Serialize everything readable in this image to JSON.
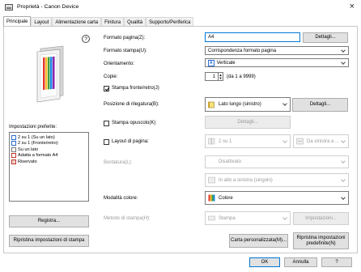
{
  "window": {
    "title": "Proprietà - Canon Device",
    "close_glyph": "×"
  },
  "tabs": [
    "Principale",
    "Layout",
    "Alimentazione carta",
    "Finitura",
    "Qualità",
    "Supporto/Periferica"
  ],
  "preview": {
    "help_glyph": "?"
  },
  "presets": {
    "label": "Impostazioni preferite:",
    "items": [
      "2 su 1 (Su un lato)",
      "2 su 1 (Fronte/retro)",
      "Su un lato",
      "Adatta a formato A4",
      "Riservato"
    ],
    "register_button": "Registra...",
    "restore_button": "Ripristina impostazioni di stampa"
  },
  "form": {
    "page_size_label": "Formato pagina(Z):",
    "page_size_value": "A4",
    "details_button": "Dettagli...",
    "print_size_label": "Formato stampa(U):",
    "print_size_value": "Corrispondenza formato pagina",
    "orientation_label": "Orientamento:",
    "orientation_value": "Verticale",
    "orientation_icon": "A",
    "copies_label": "Copie:",
    "copies_value": "1",
    "copies_range": "(da 1 a 9999)",
    "duplex_label": "Stampa fronte/retro(J)",
    "duplex_checked": true,
    "binding_label": "Posizione di rilegatura(B):",
    "binding_value": "Lato lungo (sinistro)",
    "binding_details_button": "Dettagli...",
    "booklet_label": "Stampa opuscolo(K)",
    "booklet_checked": false,
    "booklet_details_button": "Dettagli...",
    "layout_label": "Layout di pagina:",
    "layout_checked": false,
    "layout_value": "2 su 1",
    "layout_order_value": "Da sinistra a ...",
    "border_label": "Bordatura(L):",
    "border_value": "Disattivato",
    "border_order_value": "In alto a sinistra (singolo)",
    "color_mode_label": "Modalità colore:",
    "color_mode_value": "Colore",
    "print_method_label": "Metodo di stampa(H):",
    "print_method_value": "Stampa",
    "print_method_settings_button": "Impostazioni...",
    "custom_paper_button": "Carta personalizzata(M)...",
    "restore_defaults_button_line1": "Ripristina impostazioni",
    "restore_defaults_button_line2": "predefinite(N)"
  },
  "footer": {
    "ok": "OK",
    "cancel": "Annulla",
    "help": "?"
  },
  "colors": {
    "accent": "#0078d7",
    "button_face": "#e1e1e1",
    "border": "#adadad",
    "disabled_text": "#9a9a9a"
  }
}
